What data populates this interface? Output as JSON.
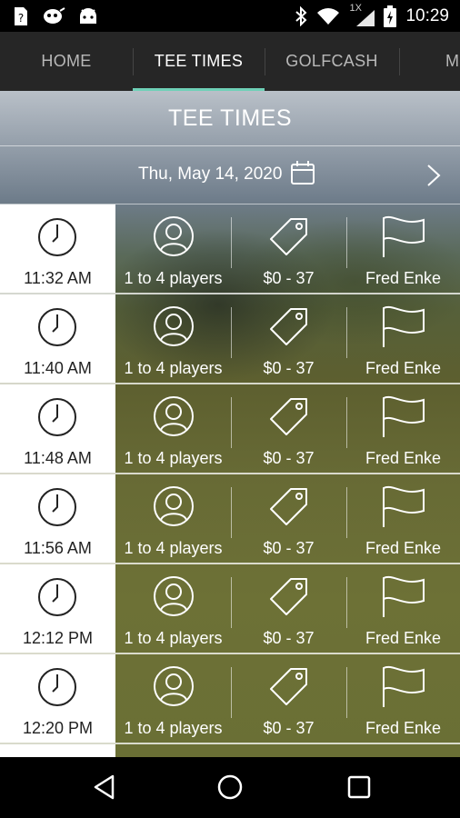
{
  "status_bar": {
    "icons_left": [
      "unknown-sim-icon",
      "alien-icon",
      "android-icon"
    ],
    "icons_right": [
      "bluetooth-icon",
      "wifi-icon",
      "signal-icon",
      "battery-charging-icon"
    ],
    "signal_label": "1X",
    "time": "10:29"
  },
  "tabs": [
    {
      "label": "HOME",
      "active": false
    },
    {
      "label": "TEE TIMES",
      "active": true
    },
    {
      "label": "GOLFCASH",
      "active": false
    },
    {
      "label": "M",
      "active": false
    }
  ],
  "page_title": "TEE TIMES",
  "date_bar": {
    "date": "Thu, May 14, 2020",
    "calendar_icon": "calendar-icon",
    "next_icon": "chevron-right-icon"
  },
  "tee_times": [
    {
      "time": "11:32 AM",
      "players": "1 to 4 players",
      "price": "$0 - 37",
      "course": "Fred Enke"
    },
    {
      "time": "11:40 AM",
      "players": "1 to 4 players",
      "price": "$0 - 37",
      "course": "Fred Enke"
    },
    {
      "time": "11:48 AM",
      "players": "1 to 4 players",
      "price": "$0 - 37",
      "course": "Fred Enke"
    },
    {
      "time": "11:56 AM",
      "players": "1 to 4 players",
      "price": "$0 - 37",
      "course": "Fred Enke"
    },
    {
      "time": "12:12 PM",
      "players": "1 to 4 players",
      "price": "$0 - 37",
      "course": "Fred Enke"
    },
    {
      "time": "12:20 PM",
      "players": "1 to 4 players",
      "price": "$0 - 37",
      "course": "Fred Enke"
    }
  ],
  "colors": {
    "accent": "#6fd0b7",
    "tab_bar": "#262626"
  },
  "nav_bar": [
    "back-icon",
    "home-icon",
    "recents-icon"
  ]
}
